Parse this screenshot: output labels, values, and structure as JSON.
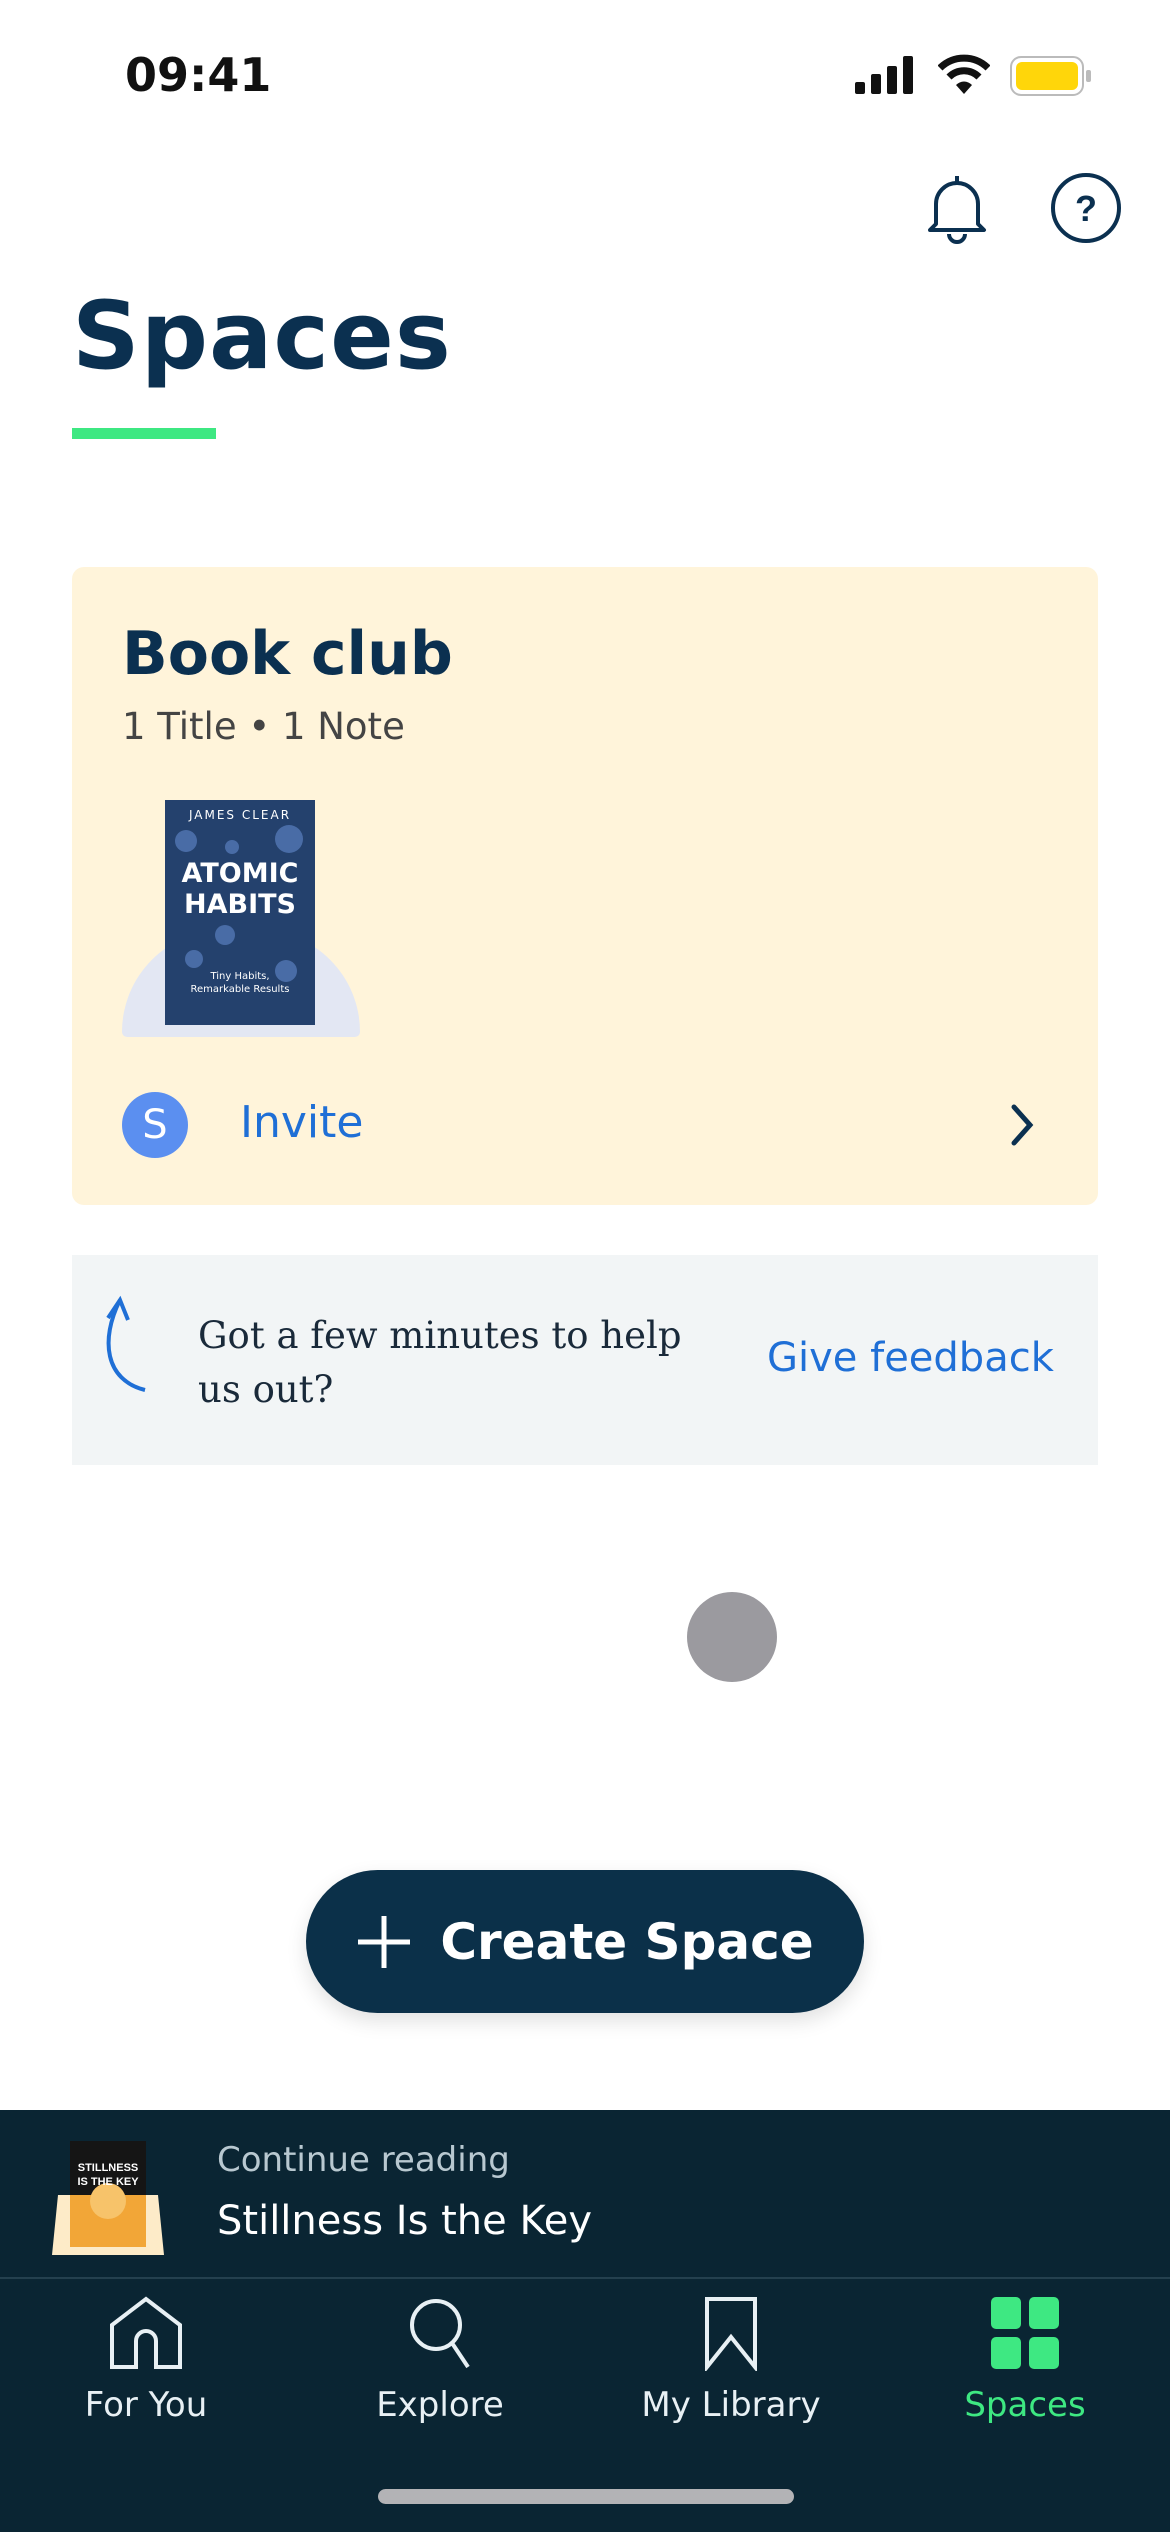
{
  "status_bar": {
    "time": "09:41"
  },
  "header": {
    "title": "Spaces",
    "icons": [
      "bell-icon",
      "help-icon"
    ]
  },
  "space_card": {
    "title": "Book club",
    "meta": "1 Title • 1 Note",
    "book": {
      "author": "JAMES CLEAR",
      "title_line1": "ATOMIC",
      "title_line2": "HABITS",
      "subtitle_line1": "Tiny Habits,",
      "subtitle_line2": "Remarkable Results"
    },
    "avatar_letter": "S",
    "invite_label": "Invite"
  },
  "feedback": {
    "text": "Got a few minutes to help us out?",
    "link": "Give feedback"
  },
  "create_button": {
    "label": "Create Space"
  },
  "mini_player": {
    "label": "Continue reading",
    "title": "Stillness Is the Key",
    "cover_text": "STILLNESS IS THE KEY"
  },
  "tabs": [
    {
      "label": "For You",
      "icon": "home-icon"
    },
    {
      "label": "Explore",
      "icon": "search-icon"
    },
    {
      "label": "My Library",
      "icon": "bookmark-icon"
    },
    {
      "label": "Spaces",
      "icon": "grid-icon",
      "active": true
    }
  ],
  "colors": {
    "accent": "#3ee882",
    "navy": "#0b3050",
    "link": "#1f6fd6",
    "card": "#fff4da",
    "nav_bg": "#0a2533"
  }
}
